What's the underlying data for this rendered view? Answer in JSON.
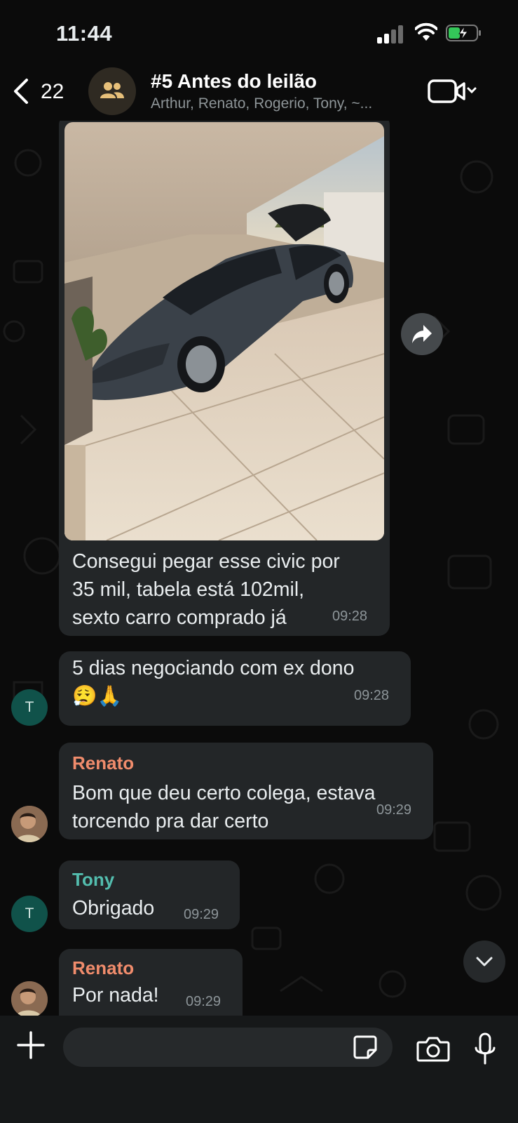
{
  "status_bar": {
    "time": "11:44",
    "battery_charging": true
  },
  "header": {
    "back_count": "22",
    "title": "#5 Antes do leilão",
    "members": "Arthur, Renato, Rogerio, Tony, ~..."
  },
  "messages": [
    {
      "type": "image",
      "caption": "Consegui pegar esse civic por\n35 mil, tabela está 102mil,\nsexto carro comprado já",
      "time": "09:28"
    },
    {
      "text": "5 dias negociando com ex dono\n😮‍💨🙏",
      "time": "09:28",
      "avatar_letter": "T"
    },
    {
      "sender": "Renato",
      "text": "Bom que deu certo colega, estava\ntorcendo pra dar certo",
      "time": "09:29"
    },
    {
      "sender": "Tony",
      "text": "Obrigado",
      "time": "09:29",
      "avatar_letter": "T"
    },
    {
      "sender": "Renato",
      "text": "Por nada!",
      "time": "09:29"
    }
  ],
  "colors": {
    "bubble": "#232628",
    "renato": "#f08c6c",
    "tony": "#53bdae",
    "background": "#0b0b0b"
  },
  "icons": [
    "chevron-left-icon",
    "group-icon",
    "video-call-icon",
    "chevron-down-icon",
    "forward-icon",
    "plus-icon",
    "sticker-icon",
    "camera-icon",
    "mic-icon"
  ]
}
